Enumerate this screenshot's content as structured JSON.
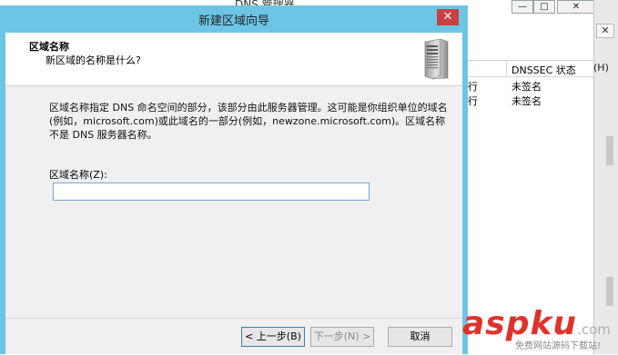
{
  "bg_window": {
    "title": "DNS 管理器",
    "controls": {
      "min": "—",
      "max": "□",
      "close": "✕"
    },
    "side_close": "✕",
    "side_label": "(H)",
    "column_header": "DNSSEC 状态",
    "rows": [
      {
        "col1": "行",
        "dnssec": "未签名"
      },
      {
        "col1": "行",
        "dnssec": "未签名"
      }
    ]
  },
  "wizard": {
    "title": "新建区域向导",
    "close": "✕",
    "heading": "区域名称",
    "subheading": "新区域的名称是什么?",
    "description": "区域名称指定 DNS 命名空间的部分，该部分由此服务器管理。这可能是你组织单位的域名(例如，microsoft.com)或此域名的一部分(例如，newzone.microsoft.com)。区域名称不是 DNS 服务器名称。",
    "zone_label": "区域名称(Z):",
    "zone_value": "",
    "buttons": {
      "back": "< 上一步(B)",
      "next": "下一步(N) >",
      "cancel": "取消"
    }
  },
  "watermark": {
    "main": "aspku",
    "tld": ".com",
    "sub": "免费网站源码下载站!"
  }
}
